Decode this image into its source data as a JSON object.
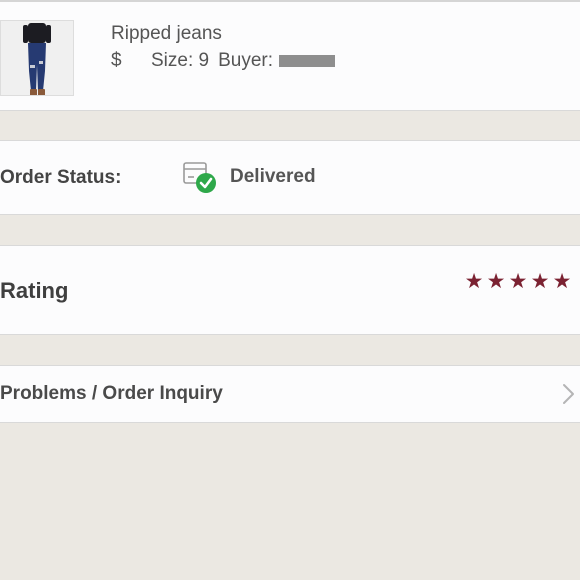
{
  "product": {
    "title": "Ripped jeans",
    "price_symbol": "$",
    "size_text": "Size: 9",
    "buyer_label": "Buyer:"
  },
  "order_status": {
    "label": "Order Status:",
    "value": "Delivered",
    "icon": "package-delivered-icon"
  },
  "rating": {
    "label": "Rating",
    "stars": 5,
    "max_stars": 5,
    "star_color": "#7b2232"
  },
  "inquiry": {
    "label": "Problems / Order Inquiry",
    "icon": "chevron-right-icon"
  },
  "colors": {
    "background": "#ebe8e2",
    "card": "#fcfcfd",
    "delivered_check": "#2ea84a"
  }
}
